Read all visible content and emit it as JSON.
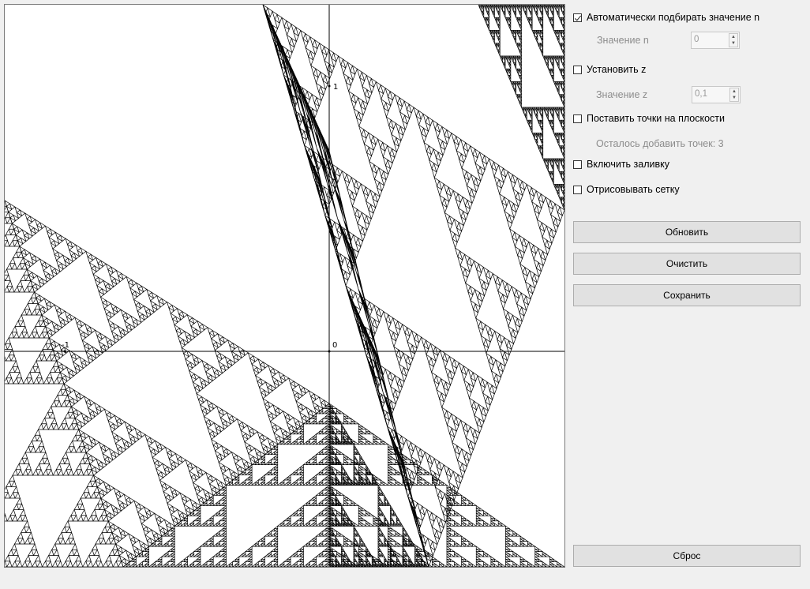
{
  "panel": {
    "auto_n": {
      "label": "Автоматически подбирать значение n",
      "checked": true
    },
    "n_field": {
      "label": "Значение n",
      "value": "0"
    },
    "set_z": {
      "label": "Установить z",
      "checked": false
    },
    "z_field": {
      "label": "Значение z",
      "value": "0,1"
    },
    "place_points": {
      "label": "Поставить точки на плоскости",
      "checked": false
    },
    "points_left": "Осталось добавить точек: 3",
    "fill": {
      "label": "Включить заливку",
      "checked": false
    },
    "grid": {
      "label": "Отрисовывать сетку",
      "checked": false
    },
    "buttons": {
      "update": "Обновить",
      "clear": "Очистить",
      "save": "Сохранить",
      "reset": "Сброс"
    }
  },
  "plot": {
    "origin_label": "0",
    "x_tick_label": "-1",
    "y_tick_label": "1",
    "fractal": "sierpinski",
    "colors": {
      "fractal": "#000000",
      "background": "#ffffff",
      "axes": "#000000"
    }
  },
  "icons": {
    "checkbox_checked": "checkmark-icon",
    "spin_up": "arrow-up-icon",
    "spin_down": "arrow-down-icon"
  }
}
